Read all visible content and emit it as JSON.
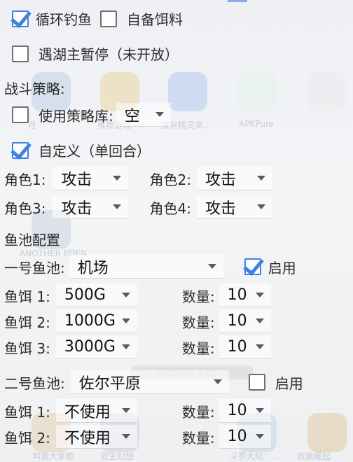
{
  "options": {
    "loop_fishing": {
      "label": "循环钓鱼",
      "checked": true
    },
    "own_bait": {
      "label": "自备饵料",
      "checked": false
    },
    "pause_on_boss": {
      "label": "遇湖主暂停（未开放）",
      "checked": false
    }
  },
  "battle": {
    "heading": "战斗策略:",
    "use_library": {
      "label": "使用策略库:",
      "checked": false,
      "value": "空"
    },
    "custom": {
      "label": "自定义（单回合）",
      "checked": true
    },
    "roles": [
      {
        "label": "角色1:",
        "value": "攻击"
      },
      {
        "label": "角色2:",
        "value": "攻击"
      },
      {
        "label": "角色3:",
        "value": "攻击"
      },
      {
        "label": "角色4:",
        "value": "攻击"
      }
    ]
  },
  "pools": {
    "heading": "鱼池配置",
    "pool1": {
      "label": "一号鱼池:",
      "value": "机场",
      "enable": {
        "label": "启用",
        "checked": true
      },
      "baits": [
        {
          "label": "鱼饵 1:",
          "value": "500G",
          "qty_label": "数量:",
          "qty": "10"
        },
        {
          "label": "鱼饵 2:",
          "value": "1000G",
          "qty_label": "数量:",
          "qty": "10"
        },
        {
          "label": "鱼饵 3:",
          "value": "3000G",
          "qty_label": "数量:",
          "qty": "10"
        }
      ]
    },
    "pool2": {
      "label": "二号鱼池:",
      "value": "佐尔平原",
      "enable": {
        "label": "启用",
        "checked": false
      },
      "baits": [
        {
          "label": "鱼饵 1:",
          "value": "不使用",
          "qty_label": "数量:",
          "qty": "10"
        },
        {
          "label": "鱼饵 2:",
          "value": "不使用",
          "qty_label": "数量:",
          "qty": "10"
        }
      ]
    }
  },
  "background": {
    "app_labels": [
      "月",
      "推荐游戏",
      "搜狗精灵高...",
      "APKPure",
      "ANOTHER EDEN",
      "叫我大掌柜",
      "双生幻想",
      "斗罗大陆：...",
      "蚁族崛起"
    ],
    "toast": "对于该设备探险手游！",
    "colors": {
      "accent": "#3e82e0"
    }
  }
}
